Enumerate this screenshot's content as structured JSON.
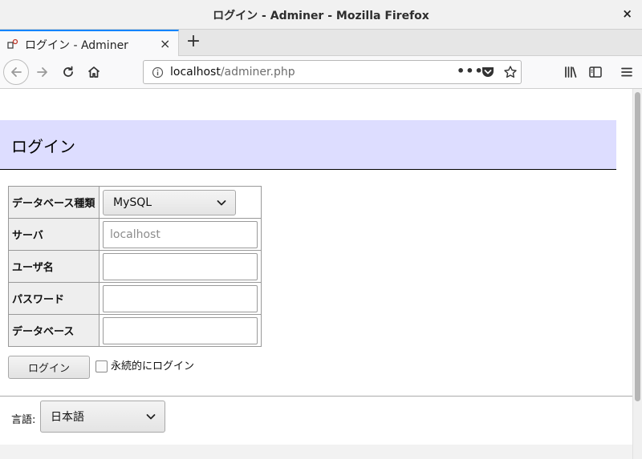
{
  "window": {
    "title": "ログイン - Adminer - Mozilla Firefox",
    "close_glyph": "×"
  },
  "tab": {
    "label": "ログイン - Adminer",
    "close_glyph": "×",
    "new_tab_glyph": "+"
  },
  "navbar": {
    "url_host": "localhost",
    "url_path": "/adminer.php",
    "page_actions_glyph": "•••"
  },
  "page": {
    "heading": "ログイン",
    "form": {
      "rows": [
        {
          "label": "データベース種類",
          "type": "select",
          "value": "MySQL"
        },
        {
          "label": "サーバ",
          "type": "input",
          "value": "",
          "placeholder": "localhost"
        },
        {
          "label": "ユーザ名",
          "type": "input",
          "value": "",
          "placeholder": ""
        },
        {
          "label": "パスワード",
          "type": "input",
          "value": "",
          "placeholder": ""
        },
        {
          "label": "データベース",
          "type": "input",
          "value": "",
          "placeholder": ""
        }
      ],
      "submit_label": "ログイン",
      "permanent_label": "永続的にログイン",
      "permanent_checked": false
    },
    "language": {
      "label": "言語:",
      "value": "日本語"
    }
  },
  "colors": {
    "heading_bg": "#ddddff",
    "tab_accent": "#0a84ff"
  }
}
